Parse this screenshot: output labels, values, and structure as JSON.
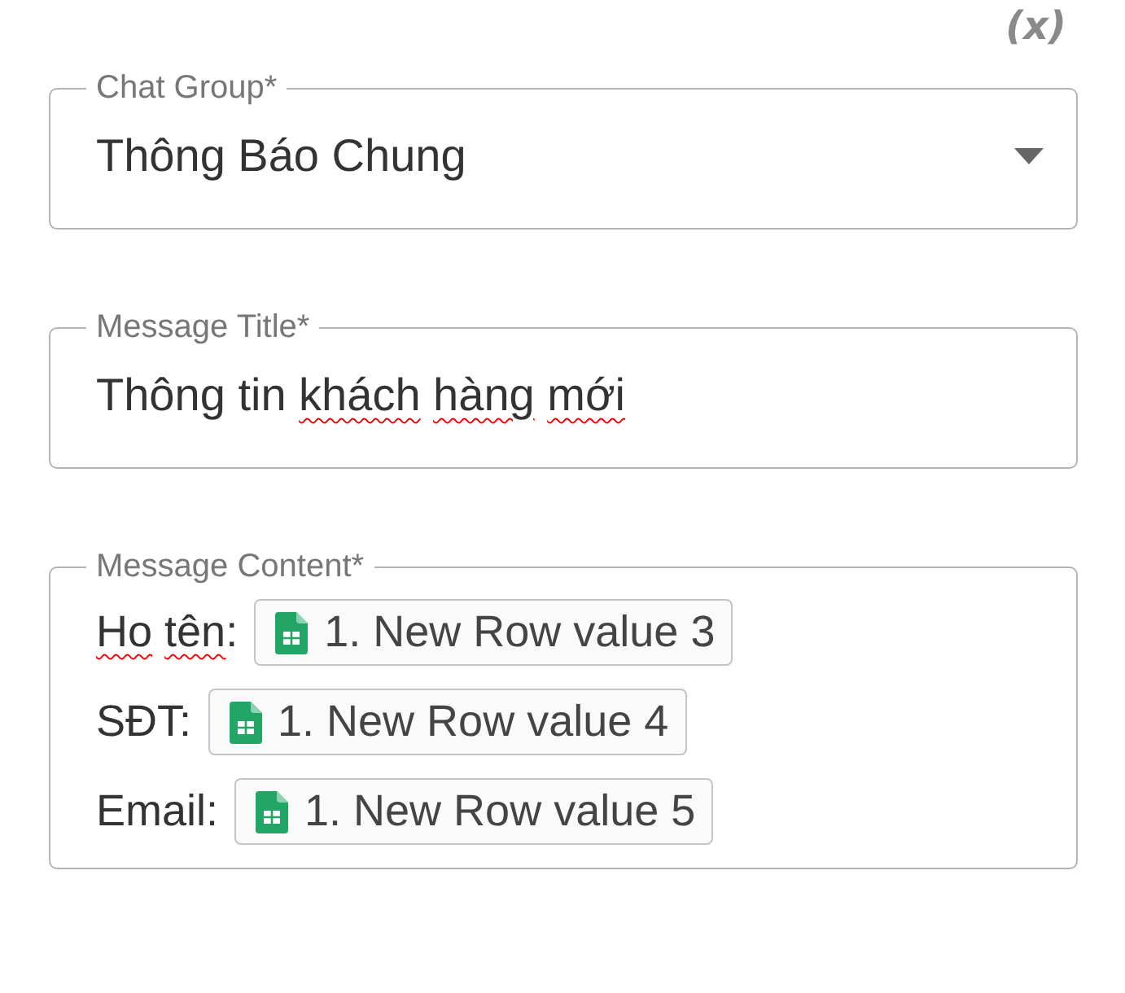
{
  "insert_variable_button": "(x)",
  "chat_group": {
    "label": "Chat Group*",
    "value": "Thông Báo Chung"
  },
  "message_title": {
    "label": "Message Title*",
    "words": [
      {
        "text": "Thông",
        "misspelled": false
      },
      {
        "text": "tin",
        "misspelled": false
      },
      {
        "text": "khách",
        "misspelled": true
      },
      {
        "text": "hàng",
        "misspelled": true
      },
      {
        "text": "mới",
        "misspelled": true
      }
    ]
  },
  "message_content": {
    "label": "Message Content*",
    "lines": [
      {
        "words": [
          {
            "text": "Ho",
            "misspelled": true
          },
          {
            "text": "tên",
            "misspelled": true
          }
        ],
        "suffix": ":",
        "variable": "1. New Row value 3"
      },
      {
        "words": [
          {
            "text": "SĐT:",
            "misspelled": false
          }
        ],
        "variable": "1. New Row value 4"
      },
      {
        "words": [
          {
            "text": "Email:",
            "misspelled": false
          }
        ],
        "variable": "1. New Row value 5"
      }
    ]
  }
}
